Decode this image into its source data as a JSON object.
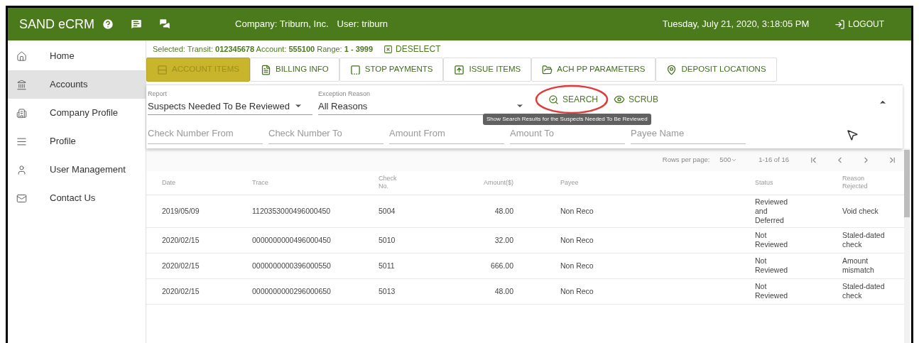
{
  "header": {
    "app_name": "SAND eCRM",
    "company": "Company: Triburn, Inc.",
    "user": "User: triburn",
    "datetime": "Tuesday, July 21, 2020, 3:18:05 PM",
    "logout": "LOGOUT"
  },
  "sidebar": {
    "items": [
      {
        "label": "Home",
        "selected": false
      },
      {
        "label": "Accounts",
        "selected": true
      },
      {
        "label": "Company Profile",
        "selected": false
      },
      {
        "label": "Profile",
        "selected": false
      },
      {
        "label": "User Management",
        "selected": false
      },
      {
        "label": "Contact Us",
        "selected": false
      }
    ]
  },
  "selection": {
    "text": "Selected: Transit: **012345678** Account: **555100** Range: **1 - 3999**",
    "deselect": "DESELECT"
  },
  "tabs": [
    {
      "label": "ACCOUNT ITEMS",
      "selected": true
    },
    {
      "label": "BILLING INFO",
      "selected": false
    },
    {
      "label": "STOP PAYMENTS",
      "selected": false
    },
    {
      "label": "ISSUE ITEMS",
      "selected": false
    },
    {
      "label": "ACH PP PARAMETERS",
      "selected": false
    },
    {
      "label": "DEPOSIT LOCATIONS",
      "selected": false
    }
  ],
  "filters": {
    "report": {
      "label": "Report",
      "value": "Suspects Needed To Be Reviewed"
    },
    "exception_reason": {
      "label": "Exception Reason",
      "value": "All Reasons"
    },
    "search": "SEARCH",
    "scrub": "SCRUB",
    "tooltip": "Show Search Results for the Suspects Needed To Be Reviewed",
    "fields": [
      {
        "placeholder": "Check Number From"
      },
      {
        "placeholder": "Check Number To"
      },
      {
        "placeholder": "Amount From"
      },
      {
        "placeholder": "Amount To"
      },
      {
        "placeholder": "Payee Name"
      }
    ]
  },
  "pagination": {
    "rows_per_page_label": "Rows per page:",
    "rows_per_page": "500",
    "range": "1-16 of 16"
  },
  "table": {
    "columns": [
      "Date",
      "Trace",
      "Check No.",
      "Amount($)",
      "Payee",
      "Status",
      "Reason Rejected"
    ],
    "rows": [
      [
        "2019/05/09",
        "1120353000496000450",
        "5004",
        "48.00",
        "Non Reco",
        "Reviewed and Deferred",
        "Void check"
      ],
      [
        "2020/02/15",
        "0000000000496000450",
        "5010",
        "32.00",
        "Non Reco",
        "Not Reviewed",
        "Staled-dated check"
      ],
      [
        "2020/02/15",
        "0000000000396000550",
        "5011",
        "666.00",
        "Non Reco",
        "Not Reviewed",
        "Amount mismatch"
      ],
      [
        "2020/02/15",
        "0000000000296000650",
        "5013",
        "48.00",
        "Non Reco",
        "Not Reviewed",
        "Staled-dated check"
      ]
    ]
  }
}
